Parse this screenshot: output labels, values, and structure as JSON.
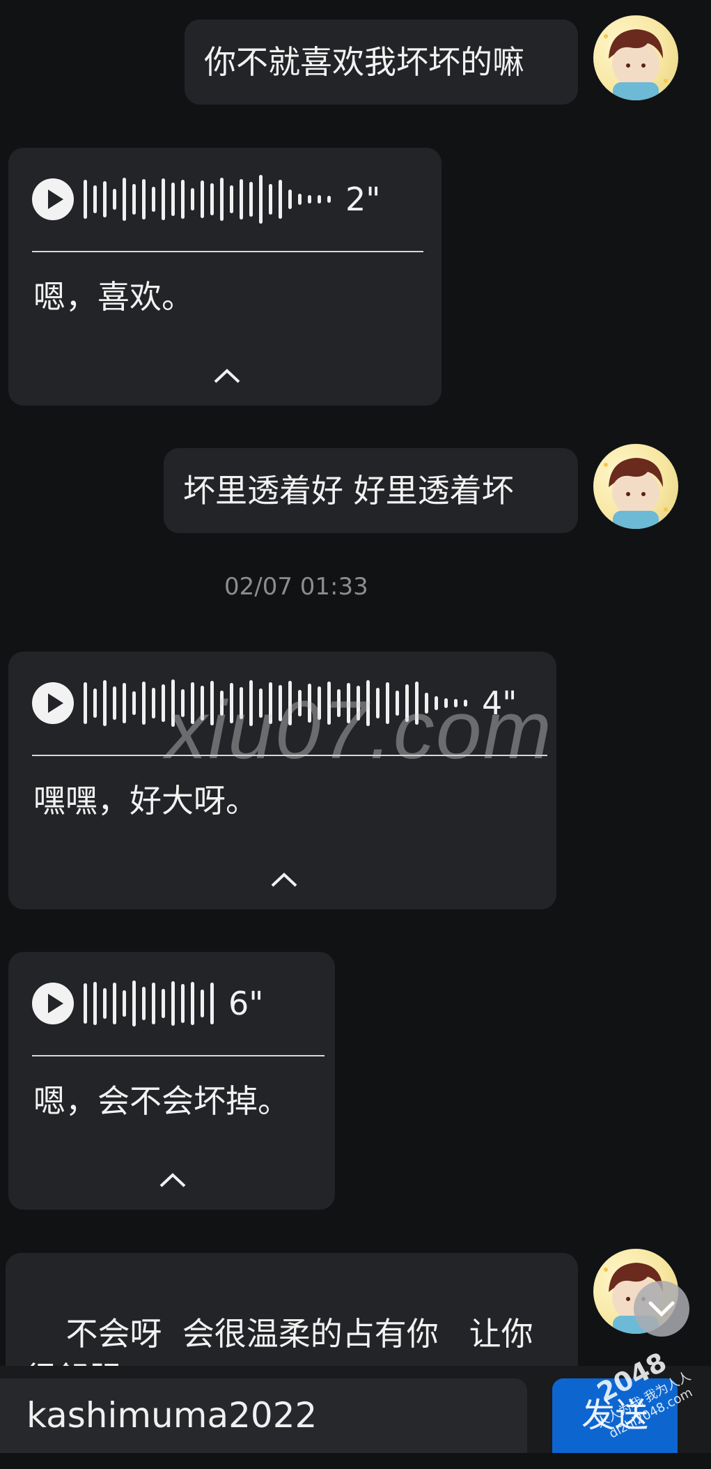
{
  "messages": {
    "m1": {
      "text": "你不就喜欢我坏坏的嘛"
    },
    "v1": {
      "duration": "2\"",
      "transcript": "嗯，喜欢。"
    },
    "m2": {
      "text": "坏里透着好  好里透着坏"
    },
    "timestamp": "02/07 01:33",
    "v2": {
      "duration": "4\"",
      "transcript": "嘿嘿，好大呀。"
    },
    "v3": {
      "duration": "6\"",
      "transcript": "嗯，会不会坏掉。"
    },
    "m3": {
      "text": "不会呀  会很温柔的占有你   让你\n很舒服"
    }
  },
  "watermark": "xiu07.com",
  "input": {
    "value": "kashimuma2022",
    "send_label": "发送"
  },
  "corner_badge": {
    "big": "2048",
    "line1": "人人为我 我为人人",
    "line2": "dizhi2048.com"
  },
  "icons": {
    "play": "play-icon",
    "collapse": "chevron-up-icon",
    "scroll": "chevron-down-icon"
  },
  "colors": {
    "background": "#111214",
    "bubble": "#232427",
    "send_button": "#0d66cf"
  }
}
